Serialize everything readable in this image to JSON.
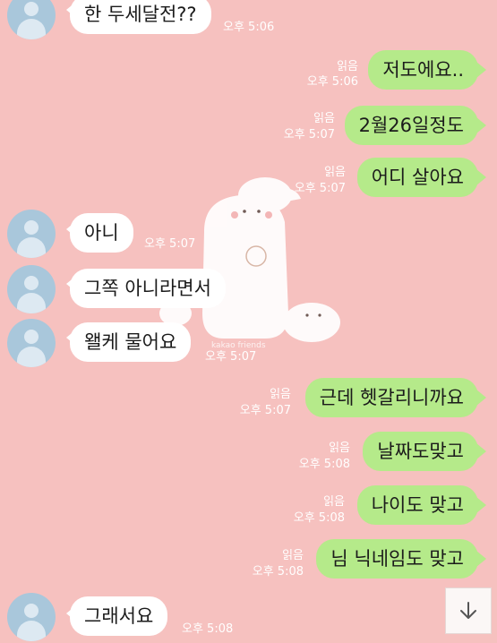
{
  "messages": [
    {
      "dir": "in",
      "text": "한 두세달전??",
      "time": "오후 5:06"
    },
    {
      "dir": "out",
      "text": "저도에요..",
      "read": "읽음",
      "time": "오후 5:06"
    },
    {
      "dir": "out",
      "text": "2월26일정도",
      "read": "읽음",
      "time": "오후 5:07"
    },
    {
      "dir": "out",
      "text": "어디 살아요",
      "read": "읽음",
      "time": "오후 5:07"
    },
    {
      "dir": "in",
      "text": "아니",
      "time": "오후 5:07"
    },
    {
      "dir": "in",
      "text": "그쪽 아니라면서",
      "time": ""
    },
    {
      "dir": "in",
      "text": "왤케 물어요",
      "time": "오후 5:07"
    },
    {
      "dir": "out",
      "text": "근데 헷갈리니까요",
      "read": "읽음",
      "time": "오후 5:07"
    },
    {
      "dir": "out",
      "text": "날짜도맞고",
      "read": "읽음",
      "time": "오후 5:08"
    },
    {
      "dir": "out",
      "text": "나이도 맞고",
      "read": "읽음",
      "time": "오후 5:08"
    },
    {
      "dir": "out",
      "text": "님 닉네임도 맞고",
      "read": "읽음",
      "time": "오후 5:08"
    },
    {
      "dir": "in",
      "text": "그래서요",
      "time": "오후 5:08"
    }
  ],
  "wallpaper": {
    "background": "#f6c1bf",
    "watermark": "kakao friends"
  },
  "colors": {
    "incoming_bubble": "#ffffff",
    "outgoing_bubble": "#b5ea8a",
    "meta_text": "#ffffff"
  },
  "scroll_button": {
    "icon": "arrow-down-icon"
  }
}
